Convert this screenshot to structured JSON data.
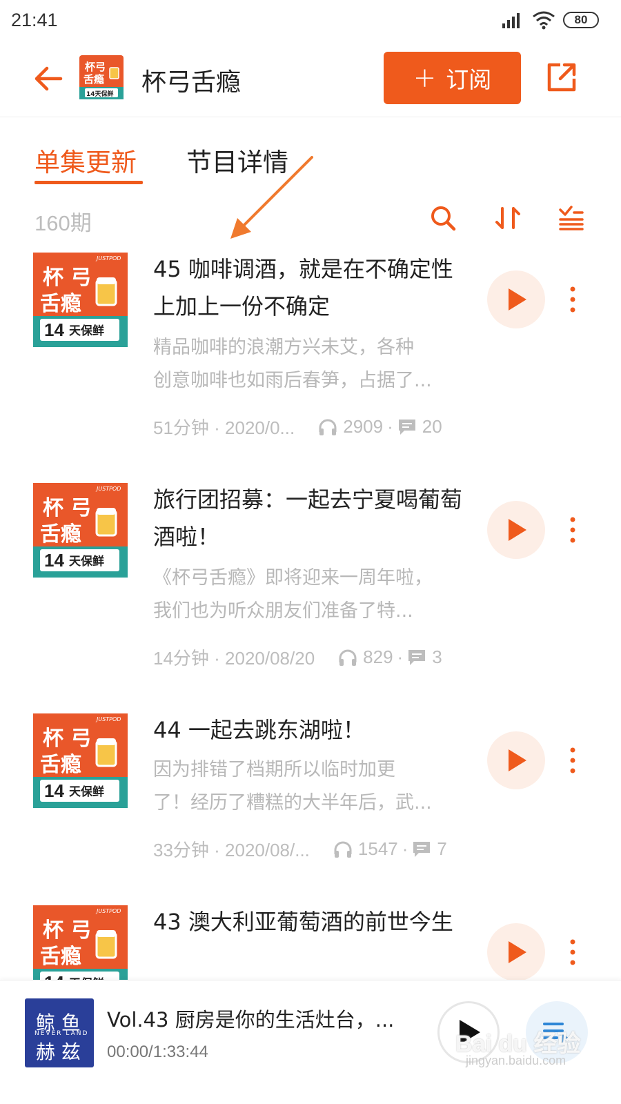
{
  "status_bar": {
    "time": "21:41",
    "battery": "80"
  },
  "header": {
    "title": "杯弓舌瘾",
    "subscribe_label": "订阅",
    "cover_text": [
      "杯弓",
      "舌瘾",
      "14天保鲜"
    ]
  },
  "tabs": [
    {
      "label": "单集更新",
      "active": true
    },
    {
      "label": "节目详情",
      "active": false
    }
  ],
  "episode_count": "160期",
  "cover": {
    "badge": "JUSTPOD",
    "line1": "杯 弓",
    "line2": "舌瘾",
    "days": "14",
    "fresh": "天保鲜"
  },
  "episodes": [
    {
      "title": "45 咖啡调酒，就是在不确定性上加上一份不确定",
      "desc_lines": [
        "精品咖啡的浪潮方兴未艾，各种",
        "创意咖啡也如雨后春笋，占据了..."
      ],
      "duration_date": "51分钟 · 2020/0...",
      "plays": "2909",
      "comments": "20"
    },
    {
      "title": "旅行团招募：一起去宁夏喝葡萄酒啦！",
      "desc_lines": [
        "《杯弓舌瘾》即将迎来一周年啦，",
        "我们也为听众朋友们准备了特..."
      ],
      "duration_date": "14分钟 · 2020/08/20",
      "plays": "829",
      "comments": "3"
    },
    {
      "title": "44 一起去跳东湖啦！",
      "desc_lines": [
        "因为排错了档期所以临时加更",
        "了！经历了糟糕的大半年后，武..."
      ],
      "duration_date": "33分钟 · 2020/08/...",
      "plays": "1547",
      "comments": "7"
    },
    {
      "title": "43 澳大利亚葡萄酒的前世今生",
      "desc_lines": [],
      "duration_date": "",
      "plays": "",
      "comments": ""
    }
  ],
  "player": {
    "title": "Vol.43 厨房是你的生活灶台，...",
    "time": "00:00/1:33:44",
    "cover_line1": "鲸 鱼",
    "cover_line2": "赫 兹",
    "cover_small": "NEVER LAND"
  },
  "watermark": {
    "brand": "Bai du 经验",
    "url": "jingyan.baidu.com"
  },
  "colors": {
    "accent": "#ef5a1c",
    "cover_orange": "#e9572a",
    "cover_teal": "#2aa198",
    "player_cover": "#2a3f99"
  }
}
